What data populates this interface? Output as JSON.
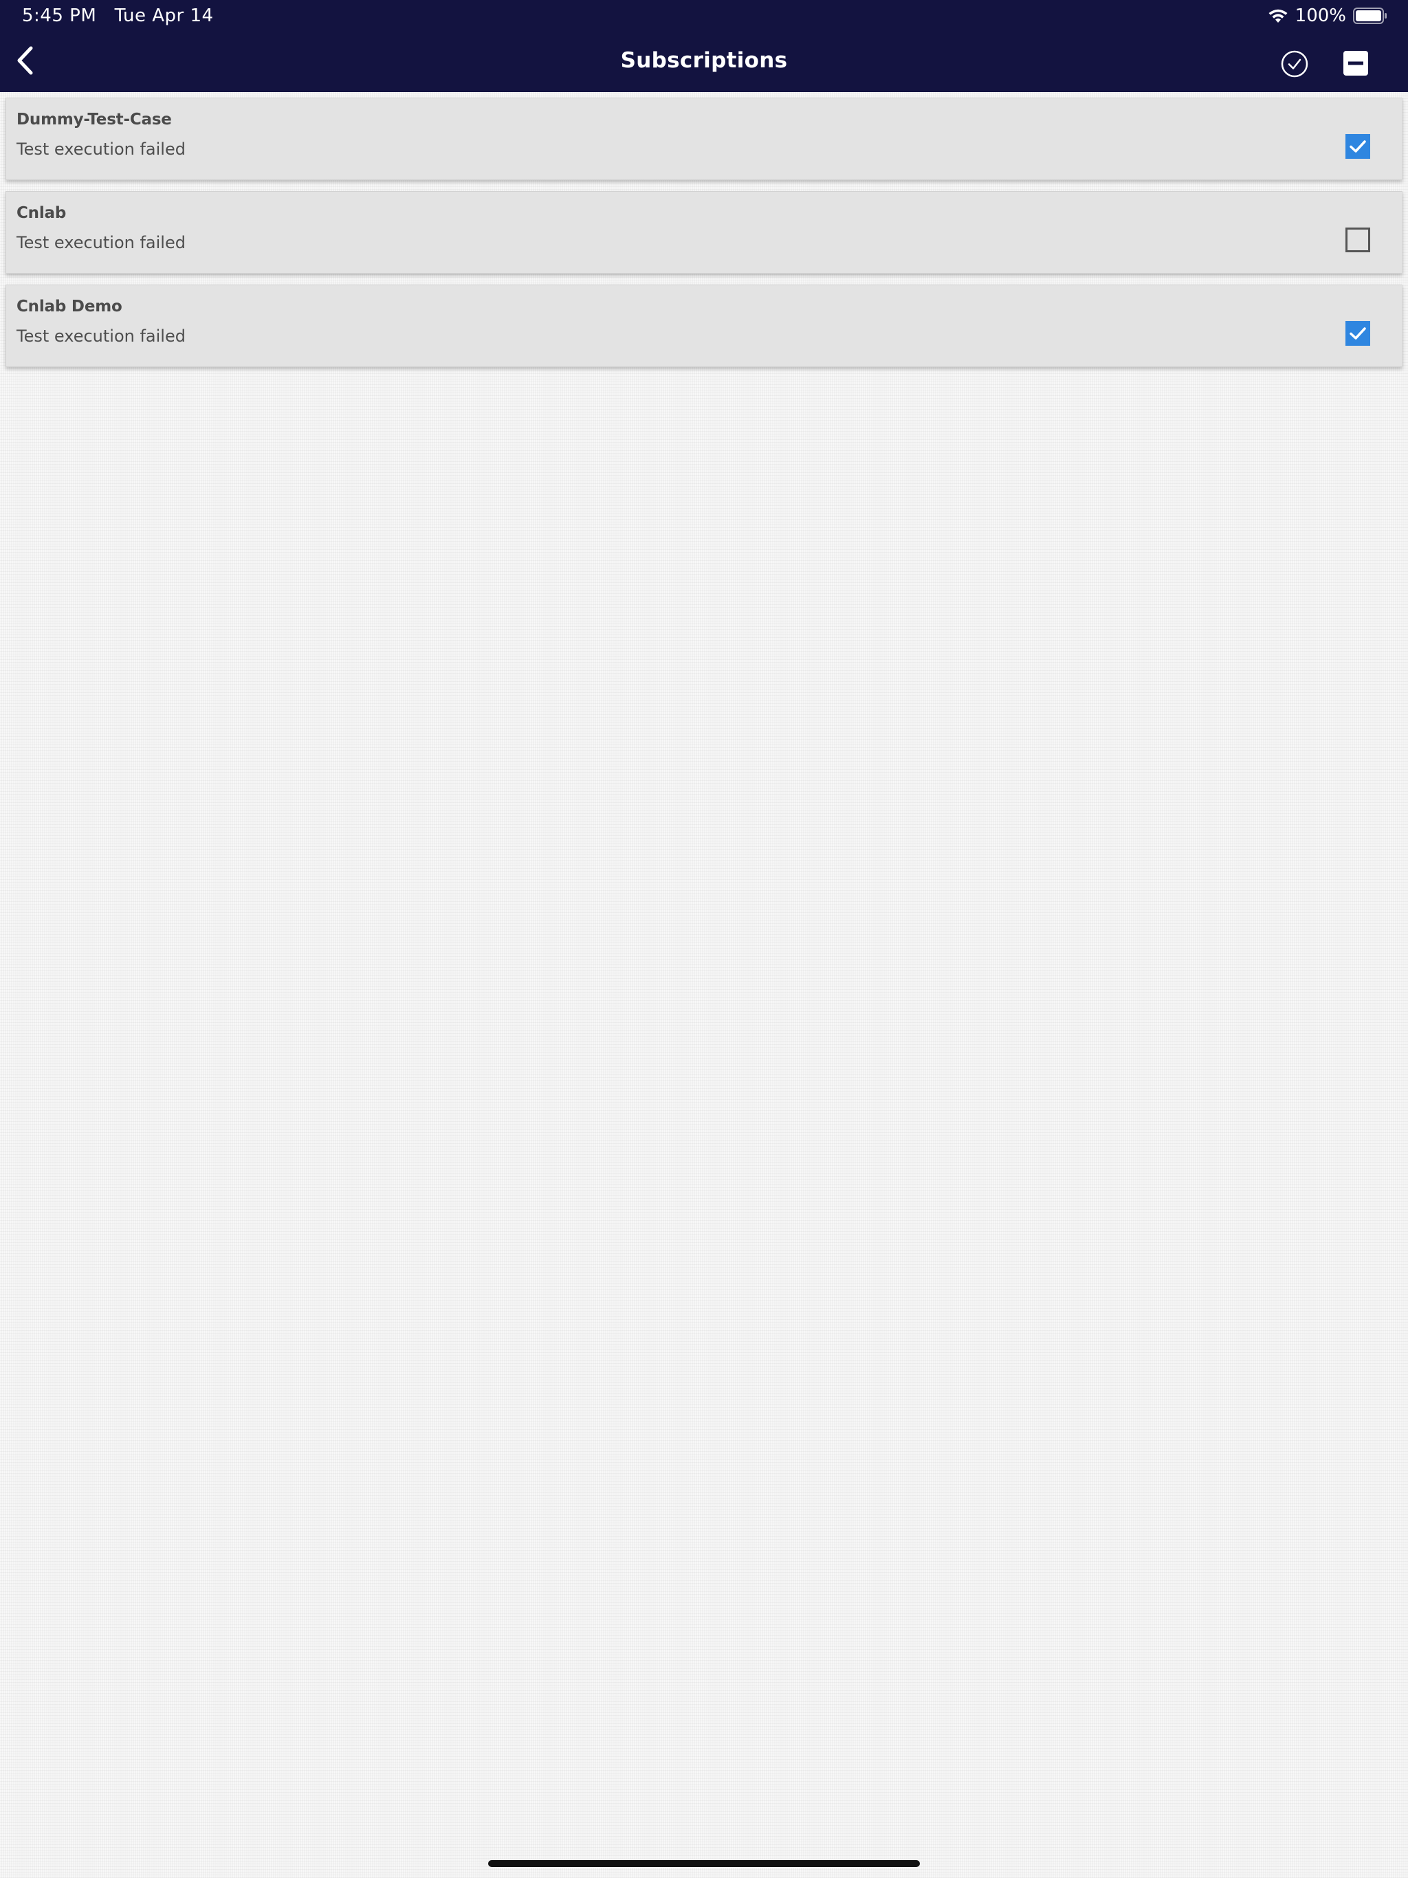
{
  "status_bar": {
    "time": "5:45 PM",
    "date": "Tue Apr 14",
    "battery_percent": "100%",
    "icons": [
      "wifi-icon",
      "battery-icon"
    ]
  },
  "nav": {
    "title": "Subscriptions",
    "back_icon": "chevron-left-icon",
    "check_all_icon": "check-circle-icon",
    "deselect_icon": "minus-square-icon"
  },
  "subscriptions": [
    {
      "name": "Dummy-Test-Case",
      "status": "Test execution failed",
      "subscribed": true
    },
    {
      "name": "Cnlab",
      "status": "Test execution failed",
      "subscribed": false
    },
    {
      "name": "Cnlab Demo",
      "status": "Test execution failed",
      "subscribed": true
    }
  ],
  "colors": {
    "header_bg": "#131340",
    "checkbox_checked": "#2f86e0",
    "card_bg": "#e3e3e3"
  }
}
